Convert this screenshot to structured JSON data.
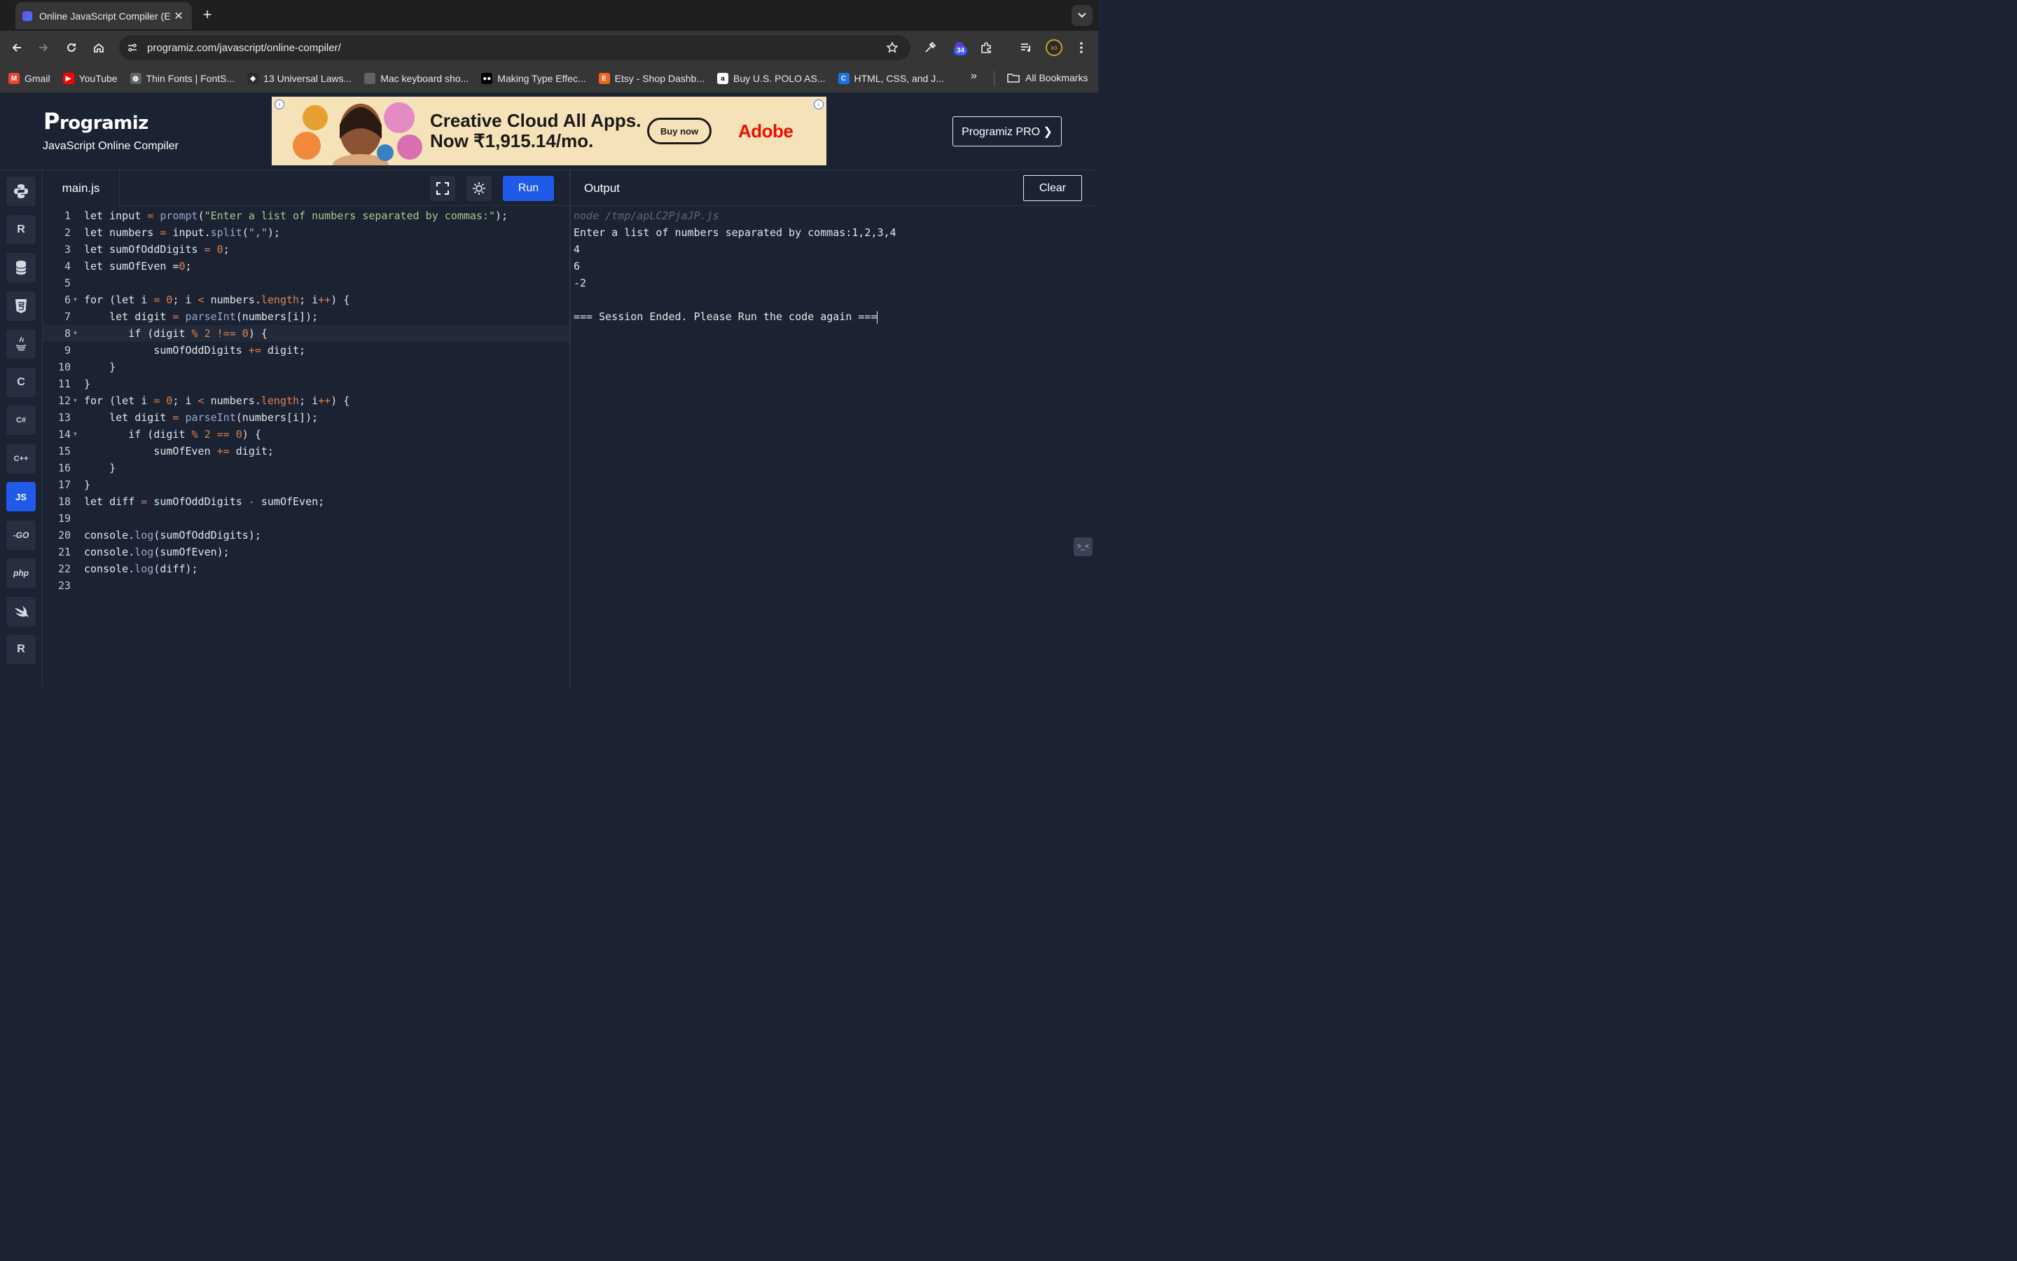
{
  "browser": {
    "tab_title": "Online JavaScript Compiler (E",
    "new_tab_symbol": "+",
    "tab_close_symbol": "✕",
    "url": "programiz.com/javascript/online-compiler/",
    "extension_badge": "34",
    "profile_initials": "xo"
  },
  "bookmarks": [
    {
      "label": "Gmail",
      "icon": "gmail-icon",
      "color": "#ea4335",
      "glyph": "M"
    },
    {
      "label": "YouTube",
      "icon": "youtube-icon",
      "color": "#ff0000",
      "glyph": "▶"
    },
    {
      "label": "Thin Fonts | FontS...",
      "icon": "globe-icon",
      "color": "#5f6368",
      "glyph": "◍"
    },
    {
      "label": "13 Universal Laws...",
      "icon": "diamond-icon",
      "color": "#2b2b2b",
      "glyph": "◆"
    },
    {
      "label": "Mac keyboard sho...",
      "icon": "apple-icon",
      "color": "#5f6368",
      "glyph": ""
    },
    {
      "label": "Making Type Effec...",
      "icon": "medium-icon",
      "color": "#000000",
      "glyph": "●●"
    },
    {
      "label": "Etsy - Shop Dashb...",
      "icon": "etsy-icon",
      "color": "#f1641e",
      "glyph": "E"
    },
    {
      "label": "Buy U.S. POLO AS...",
      "icon": "amazon-icon",
      "color": "#ffffff",
      "glyph": "a"
    },
    {
      "label": "HTML, CSS, and J...",
      "icon": "c-icon",
      "color": "#1a73e8",
      "glyph": "C"
    }
  ],
  "bookmarks_more": "»",
  "all_bookmarks": "All Bookmarks",
  "header": {
    "logo": "rogramiz",
    "logo_first": "P",
    "subtitle": "JavaScript Online Compiler",
    "pro_button": "Programiz PRO ❯"
  },
  "ad": {
    "line1": "Creative Cloud All Apps.",
    "line2": "Now ₹1,915.14/mo.",
    "button": "Buy now",
    "brand": "Adobe"
  },
  "languages": [
    {
      "name": "python-icon",
      "label": ""
    },
    {
      "name": "r-icon",
      "label": "R"
    },
    {
      "name": "database-icon",
      "label": ""
    },
    {
      "name": "html5-icon",
      "label": "5"
    },
    {
      "name": "java-icon",
      "label": ""
    },
    {
      "name": "c-icon",
      "label": "C"
    },
    {
      "name": "csharp-icon",
      "label": "C#"
    },
    {
      "name": "cpp-icon",
      "label": "C++"
    },
    {
      "name": "javascript-icon",
      "label": "JS"
    },
    {
      "name": "go-icon",
      "label": "-GO"
    },
    {
      "name": "php-icon",
      "label": "php"
    },
    {
      "name": "swift-icon",
      "label": ""
    },
    {
      "name": "rust-icon",
      "label": "R"
    }
  ],
  "editor": {
    "file_name": "main.js",
    "run_label": "Run",
    "active_line": 8,
    "lines": [
      "let input = prompt(\"Enter a list of numbers separated by commas:\");",
      "let numbers = input.split(\",\");",
      "let sumOfOddDigits = 0;",
      "let sumOfEven =0;",
      "",
      "for (let i = 0; i < numbers.length; i++) {",
      "    let digit = parseInt(numbers[i]);",
      "       if (digit % 2 !== 0) {",
      "           sumOfOddDigits += digit;",
      "    }",
      "}",
      "for (let i = 0; i < numbers.length; i++) {",
      "    let digit = parseInt(numbers[i]);",
      "       if (digit % 2 == 0) {",
      "           sumOfEven += digit;",
      "    }",
      "}",
      "let diff = sumOfOddDigits - sumOfEven;",
      "",
      "console.log(sumOfOddDigits);",
      "console.log(sumOfEven);",
      "console.log(diff);",
      ""
    ],
    "fold_lines": [
      6,
      8,
      12,
      14
    ]
  },
  "output": {
    "title": "Output",
    "clear_label": "Clear",
    "lines": [
      {
        "text": "node /tmp/apLC2PjaJP.js",
        "kind": "cmd"
      },
      {
        "text": "Enter a list of numbers separated by commas:1,2,3,4",
        "kind": "out"
      },
      {
        "text": "4",
        "kind": "out"
      },
      {
        "text": "6",
        "kind": "out"
      },
      {
        "text": "-2",
        "kind": "out"
      },
      {
        "text": "",
        "kind": "out"
      },
      {
        "text": "=== Session Ended. Please Run the code again ===",
        "kind": "out"
      }
    ],
    "fab_label": ">_<"
  },
  "colors": {
    "accent": "#1f5ae8",
    "background": "#1b2232",
    "string": "#a8c98a",
    "number": "#e0824d"
  }
}
